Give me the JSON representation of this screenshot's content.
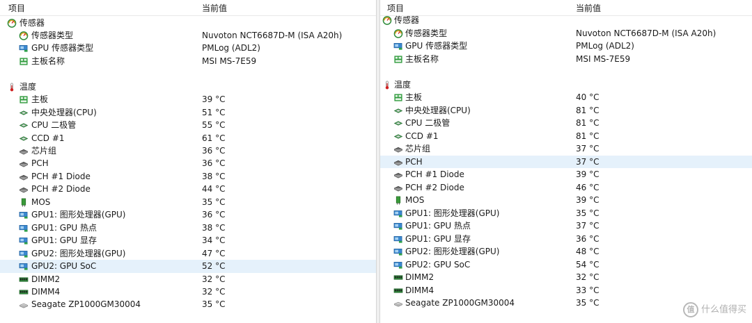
{
  "left": {
    "header": {
      "item": "项目",
      "value": "当前值"
    },
    "rows": [
      {
        "kind": "group",
        "icon": "gauge-icon",
        "label": "传感器",
        "value": ""
      },
      {
        "kind": "item",
        "icon": "gauge-icon",
        "label": "传感器类型",
        "value": "Nuvoton NCT6687D-M  (ISA A20h)"
      },
      {
        "kind": "item",
        "icon": "gpu-card-icon",
        "label": "GPU 传感器类型",
        "value": "PMLog  (ADL2)"
      },
      {
        "kind": "item",
        "icon": "motherboard-icon",
        "label": "主板名称",
        "value": "MSI MS-7E59"
      },
      {
        "kind": "blank"
      },
      {
        "kind": "group",
        "icon": "thermometer-icon",
        "label": "温度",
        "value": ""
      },
      {
        "kind": "item",
        "icon": "motherboard-icon",
        "label": "主板",
        "value": "39 °C"
      },
      {
        "kind": "item",
        "icon": "cpu-chip-icon",
        "label": "中央处理器(CPU)",
        "value": "51 °C"
      },
      {
        "kind": "item",
        "icon": "cpu-chip-icon",
        "label": "CPU 二极管",
        "value": "55 °C"
      },
      {
        "kind": "item",
        "icon": "cpu-chip-icon",
        "label": "CCD #1",
        "value": "61 °C"
      },
      {
        "kind": "item",
        "icon": "chipset-icon",
        "label": "芯片组",
        "value": "36 °C"
      },
      {
        "kind": "item",
        "icon": "chipset-icon",
        "label": "PCH",
        "value": "36 °C"
      },
      {
        "kind": "item",
        "icon": "chipset-icon",
        "label": "PCH #1 Diode",
        "value": "38 °C"
      },
      {
        "kind": "item",
        "icon": "chipset-icon",
        "label": "PCH #2 Diode",
        "value": "44 °C"
      },
      {
        "kind": "item",
        "icon": "mos-icon",
        "label": "MOS",
        "value": "35 °C"
      },
      {
        "kind": "item",
        "icon": "gpu-card-icon",
        "label": "GPU1: 图形处理器(GPU)",
        "value": "36 °C"
      },
      {
        "kind": "item",
        "icon": "gpu-card-icon",
        "label": "GPU1: GPU 热点",
        "value": "38 °C"
      },
      {
        "kind": "item",
        "icon": "gpu-card-icon",
        "label": "GPU1: GPU 显存",
        "value": "34 °C"
      },
      {
        "kind": "item",
        "icon": "gpu-card-icon",
        "label": "GPU2: 图形处理器(GPU)",
        "value": "47 °C"
      },
      {
        "kind": "item",
        "icon": "gpu-card-icon",
        "label": "GPU2: GPU SoC",
        "value": "52 °C",
        "selected": true
      },
      {
        "kind": "item",
        "icon": "dimm-icon",
        "label": "DIMM2",
        "value": "32 °C"
      },
      {
        "kind": "item",
        "icon": "dimm-icon",
        "label": "DIMM4",
        "value": "32 °C"
      },
      {
        "kind": "item",
        "icon": "hdd-icon",
        "label": "Seagate ZP1000GM30004",
        "value": "35 °C"
      }
    ]
  },
  "right": {
    "header": {
      "item": "项目",
      "value": "当前值"
    },
    "rows": [
      {
        "kind": "group",
        "icon": "gauge-icon",
        "label": "传感器",
        "value": ""
      },
      {
        "kind": "item",
        "icon": "gauge-icon",
        "label": "传感器类型",
        "value": "Nuvoton NCT6687D-M  (ISA A20h)"
      },
      {
        "kind": "item",
        "icon": "gpu-card-icon",
        "label": "GPU 传感器类型",
        "value": "PMLog  (ADL2)"
      },
      {
        "kind": "item",
        "icon": "motherboard-icon",
        "label": "主板名称",
        "value": "MSI MS-7E59"
      },
      {
        "kind": "blank"
      },
      {
        "kind": "group",
        "icon": "thermometer-icon",
        "label": "温度",
        "value": ""
      },
      {
        "kind": "item",
        "icon": "motherboard-icon",
        "label": "主板",
        "value": "40 °C"
      },
      {
        "kind": "item",
        "icon": "cpu-chip-icon",
        "label": "中央处理器(CPU)",
        "value": "81 °C"
      },
      {
        "kind": "item",
        "icon": "cpu-chip-icon",
        "label": "CPU 二极管",
        "value": "81 °C"
      },
      {
        "kind": "item",
        "icon": "cpu-chip-icon",
        "label": "CCD #1",
        "value": "81 °C"
      },
      {
        "kind": "item",
        "icon": "chipset-icon",
        "label": "芯片组",
        "value": "37 °C"
      },
      {
        "kind": "item",
        "icon": "chipset-icon",
        "label": "PCH",
        "value": "37 °C",
        "selected": true
      },
      {
        "kind": "item",
        "icon": "chipset-icon",
        "label": "PCH #1 Diode",
        "value": "39 °C"
      },
      {
        "kind": "item",
        "icon": "chipset-icon",
        "label": "PCH #2 Diode",
        "value": "46 °C"
      },
      {
        "kind": "item",
        "icon": "mos-icon",
        "label": "MOS",
        "value": "39 °C"
      },
      {
        "kind": "item",
        "icon": "gpu-card-icon",
        "label": "GPU1: 图形处理器(GPU)",
        "value": "35 °C"
      },
      {
        "kind": "item",
        "icon": "gpu-card-icon",
        "label": "GPU1: GPU 热点",
        "value": "37 °C"
      },
      {
        "kind": "item",
        "icon": "gpu-card-icon",
        "label": "GPU1: GPU 显存",
        "value": "36 °C"
      },
      {
        "kind": "item",
        "icon": "gpu-card-icon",
        "label": "GPU2: 图形处理器(GPU)",
        "value": "48 °C"
      },
      {
        "kind": "item",
        "icon": "gpu-card-icon",
        "label": "GPU2: GPU SoC",
        "value": "54 °C"
      },
      {
        "kind": "item",
        "icon": "dimm-icon",
        "label": "DIMM2",
        "value": "32 °C"
      },
      {
        "kind": "item",
        "icon": "dimm-icon",
        "label": "DIMM4",
        "value": "33 °C"
      },
      {
        "kind": "item",
        "icon": "hdd-icon",
        "label": "Seagate ZP1000GM30004",
        "value": "35 °C"
      }
    ]
  },
  "watermark": {
    "badge": "值",
    "text": "什么值得买"
  }
}
